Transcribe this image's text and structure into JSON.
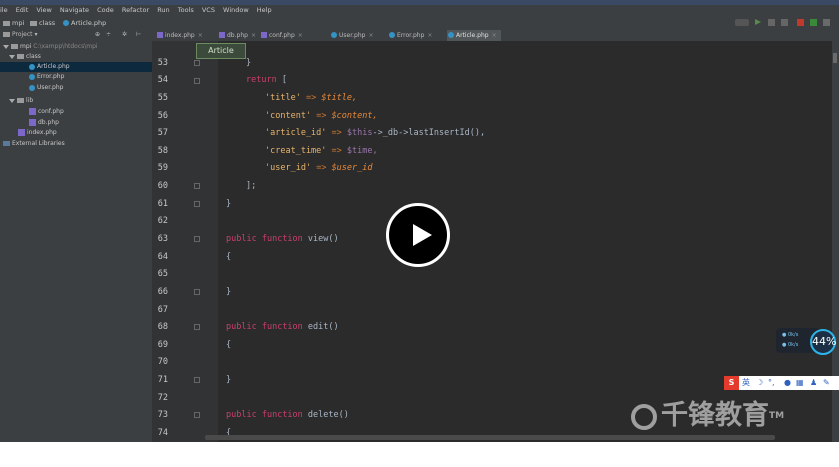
{
  "menubar": {
    "items": [
      "ile",
      "Edit",
      "View",
      "Navigate",
      "Code",
      "Refactor",
      "Run",
      "Tools",
      "VCS",
      "Window",
      "Help"
    ]
  },
  "breadcrumb": {
    "items": [
      "mpi",
      "class",
      "Article.php"
    ]
  },
  "project_panel": {
    "title": "Project"
  },
  "project_tree": {
    "root": "mpi",
    "root_path": "C:\\xampp\\htdocs\\mpi",
    "class_folder": "class",
    "class_files": [
      "Article.php",
      "Error.php",
      "User.php"
    ],
    "lib_folder": "lib",
    "lib_files": [
      "conf.php",
      "db.php"
    ],
    "index_file": "index.php",
    "external": "External Libraries"
  },
  "tabs": {
    "items": [
      {
        "label": "index.php"
      },
      {
        "label": "db.php"
      },
      {
        "label": "conf.php"
      },
      {
        "label": "User.php"
      },
      {
        "label": "Error.php"
      },
      {
        "label": "Article.php"
      }
    ],
    "active_index": 5
  },
  "tooltip": {
    "text": "Article"
  },
  "editor": {
    "line_numbers": [
      "53",
      "54",
      "55",
      "56",
      "57",
      "58",
      "59",
      "60",
      "61",
      "62",
      "63",
      "64",
      "65",
      "66",
      "67",
      "68",
      "69",
      "70",
      "71",
      "72",
      "73",
      "74"
    ],
    "code": {
      "l53_brace": "}",
      "l54_return": "return",
      "l54_bracket": "[",
      "l55_key": "'title'",
      "l55_arrow": "=>",
      "l55_val": "$title,",
      "l56_key": "'content'",
      "l56_arrow": "=>",
      "l56_val": "$content,",
      "l57_key": "'article_id'",
      "l57_arrow": "=>",
      "l57_this": "$this",
      "l57_rest": "->_db->lastInsertId(),",
      "l58_key": "'creat_time'",
      "l58_arrow": "=>",
      "l58_val": "$time,",
      "l59_key": "'user_id'",
      "l59_arrow": "=>",
      "l59_val": "$user_id",
      "l60_bracket": "];",
      "l61_brace": "}",
      "public": "public",
      "function": "function",
      "l63_name": "view",
      "l68_name": "edit",
      "l73_name": "delete",
      "parens": "()",
      "open_brace": "{",
      "close_brace": "}"
    }
  },
  "overlay": {
    "play_label": "Play video"
  },
  "net_widget": {
    "up": "0k/s",
    "down": "0k/s",
    "percent": "44%"
  },
  "ime": {
    "badge": "S",
    "label": "英"
  },
  "watermark": {
    "text": "千锋教育",
    "tm": "TM"
  },
  "colors": {
    "keyword": "#cc7832",
    "public_keyword": "#cc3f6a",
    "string": "#e8b46b",
    "variable": "#e88a3a",
    "accent": "#4a88c7"
  }
}
